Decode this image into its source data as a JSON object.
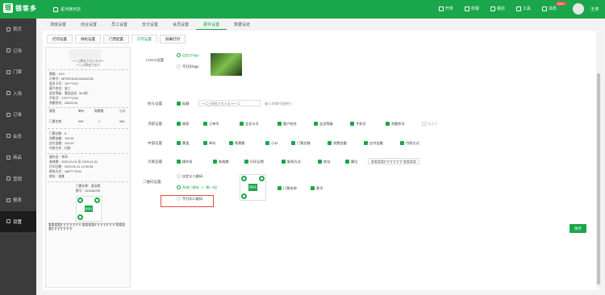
{
  "topbar": {
    "brand": "银客多",
    "store": "星河演示店",
    "menu": [
      {
        "icon": "calendar-icon",
        "label": "开单"
      },
      {
        "icon": "bell-icon",
        "label": "收银"
      },
      {
        "icon": "shop-icon",
        "label": "租店"
      },
      {
        "icon": "tool-icon",
        "label": "工具"
      },
      {
        "icon": "message-icon",
        "label": "消息"
      }
    ],
    "badge": "999+",
    "user": "王涛"
  },
  "sidebar": [
    "首页",
    "订场",
    "门票",
    "入场",
    "订单",
    "会员",
    "商品",
    "营销",
    "报表",
    "设置"
  ],
  "sidebar_active": 9,
  "top_tabs": [
    "场馆设置",
    "前台设置",
    "员工设置",
    "支付设置",
    "会员设置",
    "硬件设置",
    "数据设定"
  ],
  "top_tab_active": 5,
  "sub_tabs": [
    "打印设置",
    "闸机设置",
    "门票配置",
    "打印设置",
    "屏幕打印"
  ],
  "sub_tab_active": 3,
  "receipt": {
    "header1": "一二三四五六七八九十一",
    "header2": "一二三四五六七八",
    "lines1": [
      "票据：XXX",
      "订单号：MP2023041216161234",
      "会员卡号：15****123",
      "客户姓名：张三",
      "会员等级：黄金会员（8.0折）",
      "手机号：173****1234",
      "余额余次：25023.33"
    ],
    "table_head": [
      "票类",
      "单价",
      "购票数",
      "小计"
    ],
    "table_row": [
      "门票名称",
      "999",
      "1",
      "999"
    ],
    "lines2": [
      "门票总数：6",
      "消费金额：123.52",
      "应付金额：123.52",
      "付款方式：扫码"
    ],
    "lines3": [
      "操作员：李四",
      "有效期：2023-01-01 至 2023-12-31",
      "打印日期：2023-01-01 12:30:36",
      "联系方式：186****1234",
      "地址：某某"
    ],
    "ticket_name": "门票名称：游泳票",
    "ticket_no": "票号：123456789",
    "qr_center": "银客多",
    "footer": "看看看看扩扩扩扩扩扩扩看看看看扩扩扩扩扩扩扩看看看看扩扩扩扩扩扩扩"
  },
  "form": {
    "logo_label": "LOGO设置:",
    "logo_options": [
      "自定义logo",
      "不打印logo"
    ],
    "header_label": "抬头设置:",
    "header_cb": "标题",
    "header_value": "一二三四五六七八九十一二",
    "header_placeholder": "输入你得代表抬行",
    "top_label": "顶部设置:",
    "top_items": [
      "商家",
      "订单号",
      "会员卡号",
      "客户姓名",
      "会员等级",
      "手机号",
      "余额余次",
      "抵达号"
    ],
    "mid_label": "中部设置:",
    "mid_items": [
      "票类",
      "单价",
      "购票数",
      "小计",
      "门票总数",
      "消费金额",
      "应付金额",
      "付款方式"
    ],
    "footer_label": "页尾设置:",
    "footer_items": [
      "操作员",
      "有效期",
      "打印日期",
      "联系方式",
      "地址",
      "脚注"
    ],
    "footer_input": "看看看看扩扩扩扩扩扩看看看看",
    "qr_label": "二维码设置:",
    "qr_options": [
      "自定义二维码",
      "系统门票码（一票一码）",
      "不打印二维码"
    ],
    "qr_items": [
      "门票名称",
      "票号"
    ],
    "save": "保存"
  }
}
